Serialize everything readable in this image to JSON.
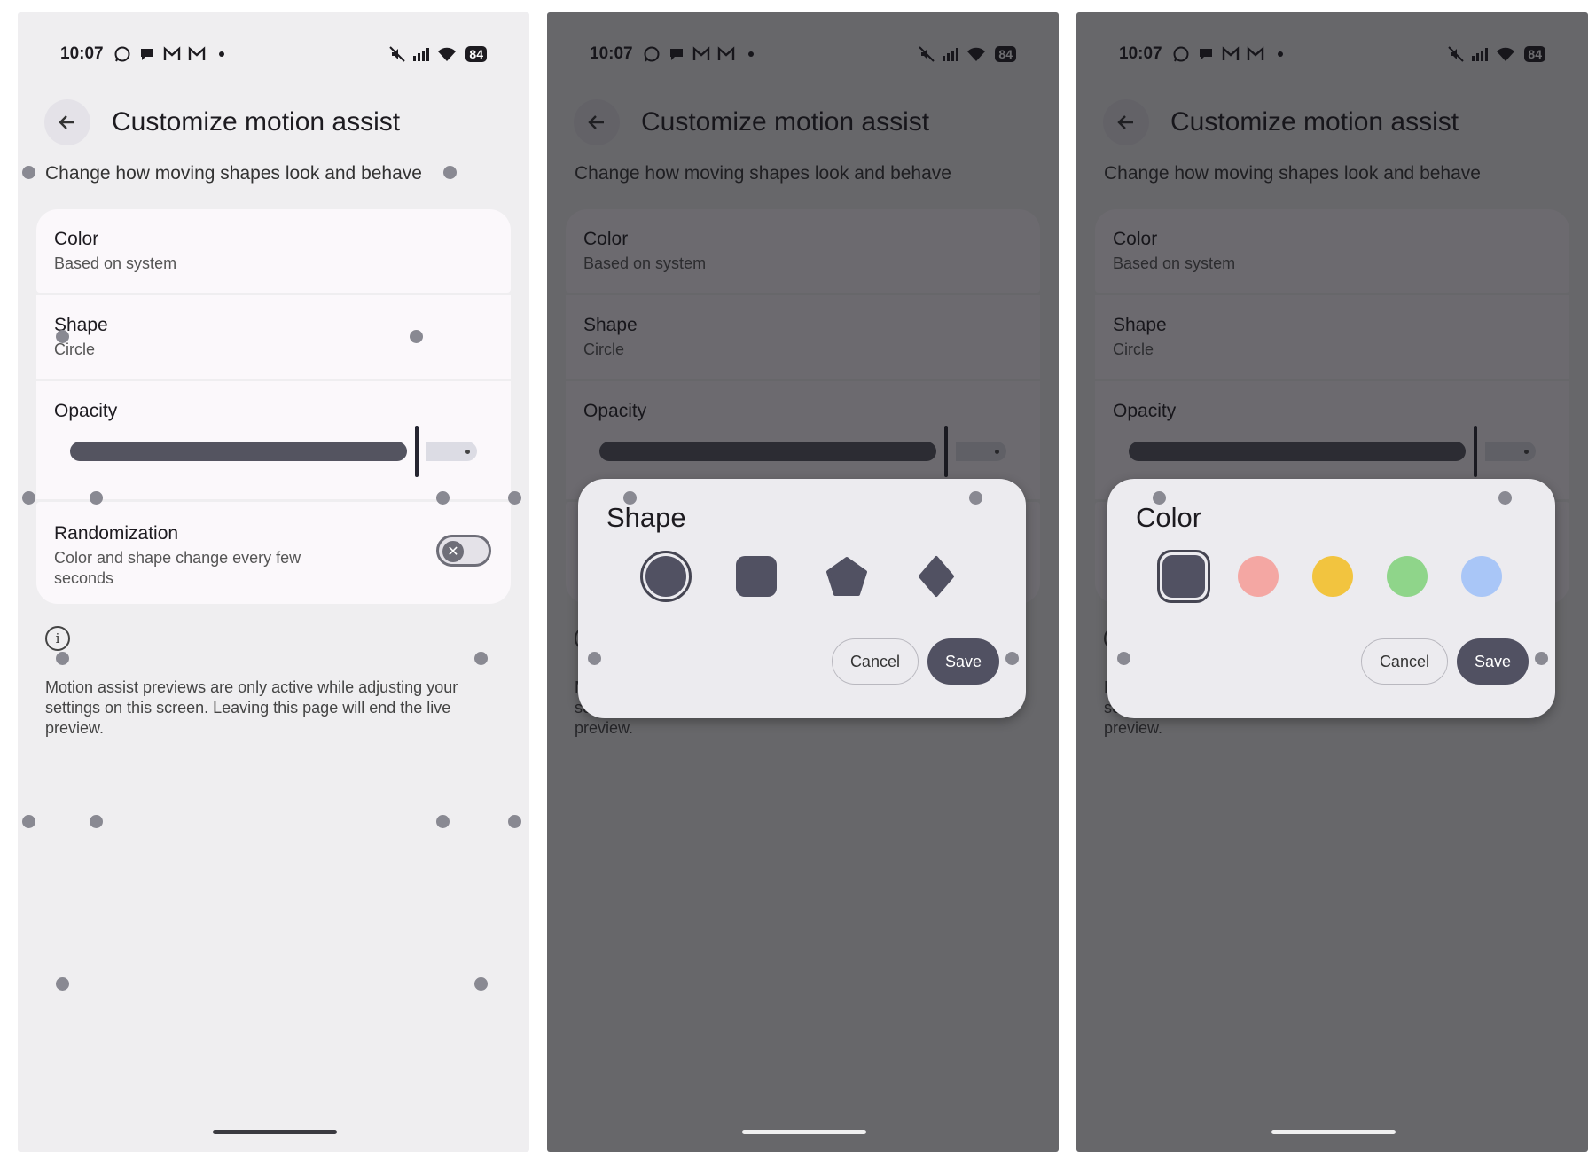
{
  "status": {
    "time": "10:07",
    "battery": "84"
  },
  "header": {
    "title": "Customize motion assist",
    "subtitle": "Change how moving shapes look and behave"
  },
  "settings": {
    "color": {
      "title": "Color",
      "value": "Based on system"
    },
    "shape": {
      "title": "Shape",
      "value": "Circle"
    },
    "opacity": {
      "title": "Opacity",
      "level_fraction": 0.86
    },
    "randomization": {
      "title": "Randomization",
      "description": "Color and shape change every few seconds",
      "enabled": false
    }
  },
  "info_note": "Motion assist previews are only active while adjusting your settings on this screen. Leaving this page will end the live preview.",
  "shape_dialog": {
    "title": "Shape",
    "options": [
      "circle-icon",
      "rounded-square-icon",
      "pentagon-icon",
      "diamond-icon"
    ],
    "selected": "circle-icon",
    "cancel_label": "Cancel",
    "save_label": "Save"
  },
  "color_dialog": {
    "title": "Color",
    "swatches": [
      "#515162",
      "#f4a7a3",
      "#f2c43f",
      "#8fd58a",
      "#a9c6f7"
    ],
    "selected": "#515162",
    "cancel_label": "Cancel",
    "save_label": "Save"
  },
  "colors": {
    "accent": "#515162",
    "scrim": "rgba(20,20,24,0.62)"
  }
}
